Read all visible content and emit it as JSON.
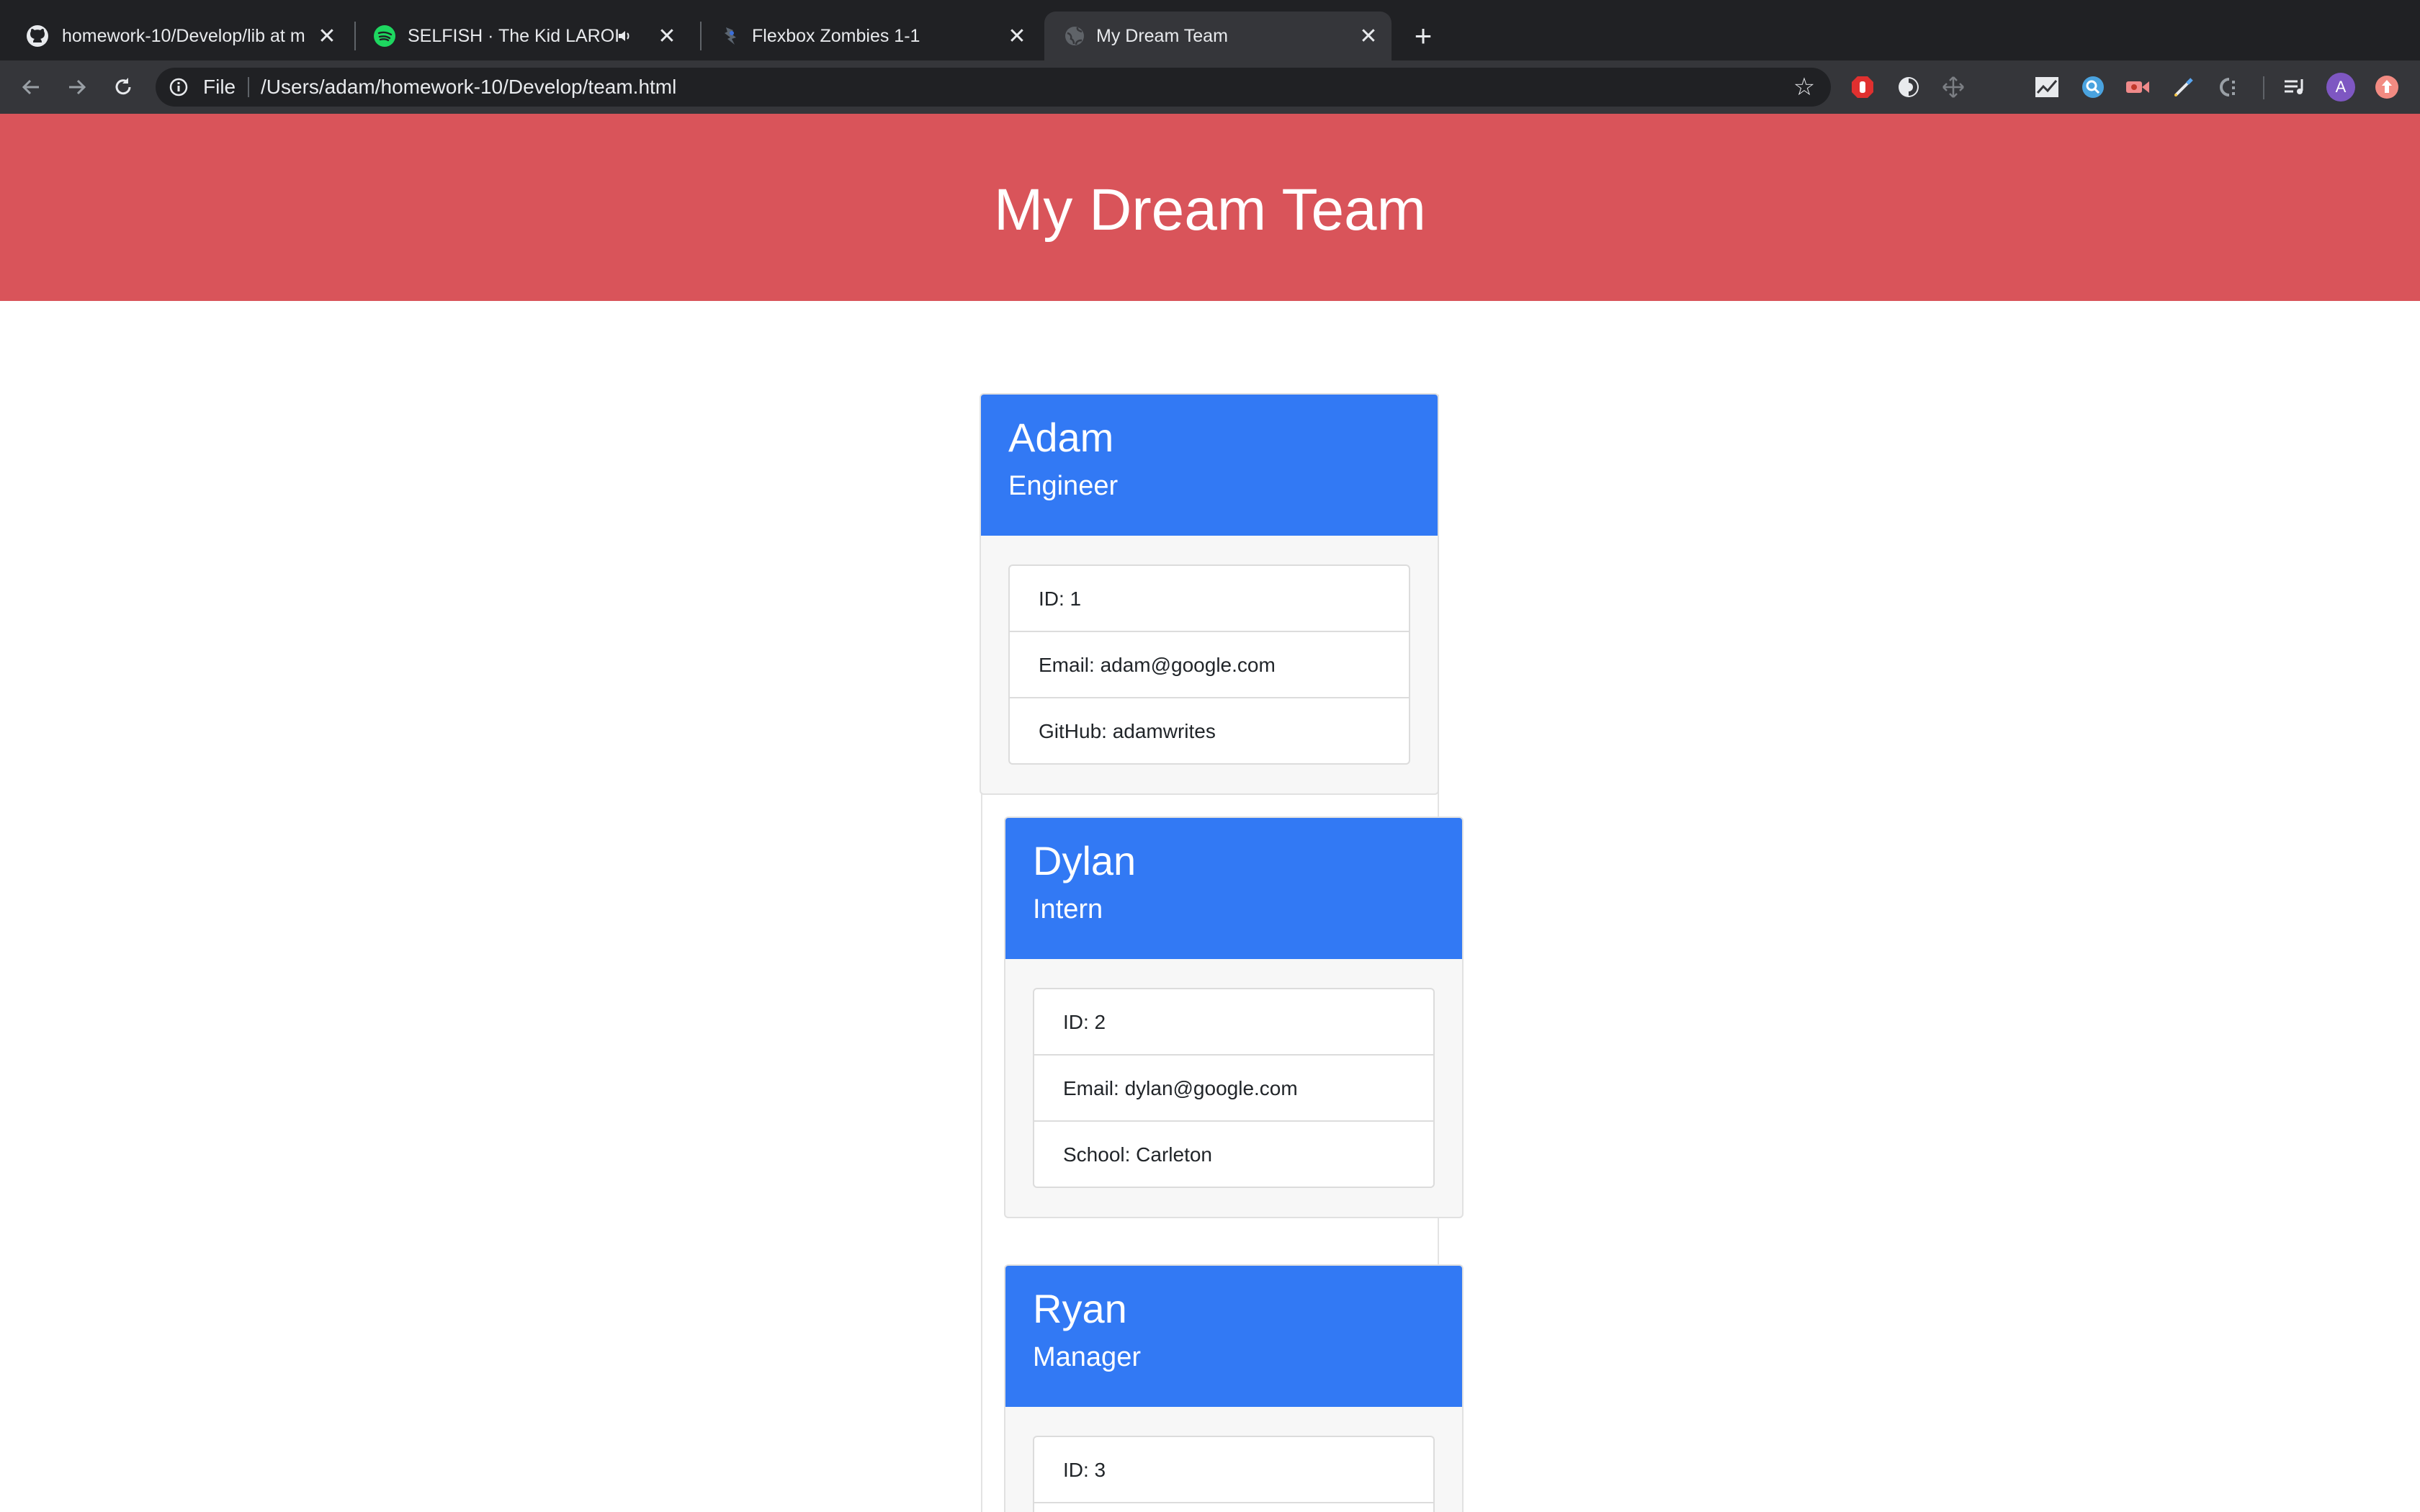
{
  "browser": {
    "tabs": [
      {
        "title": "homework-10/Develop/lib at m",
        "favicon": "github-icon"
      },
      {
        "title": "SELFISH · The Kid LAROI",
        "favicon": "spotify-icon",
        "audio": "speaker-icon"
      },
      {
        "title": "Flexbox Zombies 1-1",
        "favicon": "zombie-icon"
      },
      {
        "title": "My Dream Team",
        "favicon": "globe-icon"
      }
    ],
    "omnibox": {
      "scheme": "File",
      "url": "/Users/adam/homework-10/Develop/team.html"
    },
    "profile_initial": "A",
    "colors": {
      "tab_strip": "#202124",
      "toolbar": "#35363a"
    }
  },
  "page": {
    "title": "My Dream Team",
    "colors": {
      "banner": "#d9545a",
      "card_header": "#3279f4"
    },
    "employees": [
      {
        "name": "Adam",
        "role": "Engineer",
        "details": [
          "ID: 1",
          "Email: adam@google.com",
          "GitHub: adamwrites"
        ]
      },
      {
        "name": "Dylan",
        "role": "Intern",
        "details": [
          "ID: 2",
          "Email: dylan@google.com",
          "School: Carleton"
        ]
      },
      {
        "name": "Ryan",
        "role": "Manager",
        "details": [
          "ID: 3"
        ]
      }
    ]
  }
}
